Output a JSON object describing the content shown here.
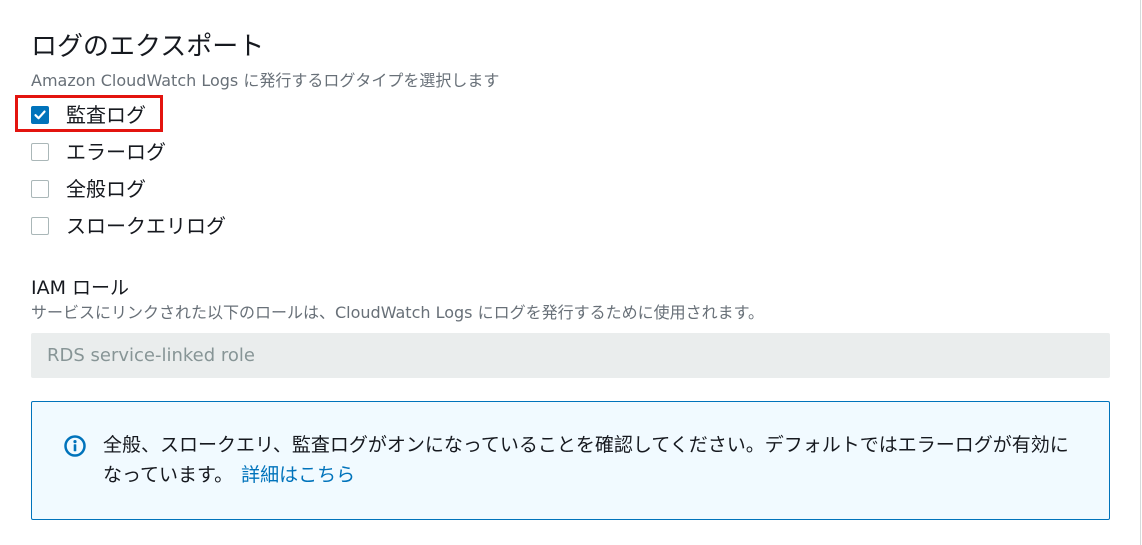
{
  "log_export": {
    "title": "ログのエクスポート",
    "description": "Amazon CloudWatch Logs に発行するログタイプを選択します",
    "options": [
      {
        "label": "監査ログ",
        "checked": true
      },
      {
        "label": "エラーログ",
        "checked": false
      },
      {
        "label": "全般ログ",
        "checked": false
      },
      {
        "label": "スロークエリログ",
        "checked": false
      }
    ]
  },
  "iam_role": {
    "label": "IAM ロール",
    "description": "サービスにリンクされた以下のロールは、CloudWatch Logs にログを発行するために使用されます。",
    "value": "RDS service-linked role"
  },
  "info_alert": {
    "text": "全般、スロークエリ、監査ログがオンになっていることを確認してください。デフォルトではエラーログが有効になっています。",
    "link_label": "詳細はこちら",
    "icon": "info-icon"
  },
  "colors": {
    "accent": "#0073bb",
    "highlight": "#e3140f",
    "alert_bg": "#f1faff"
  }
}
